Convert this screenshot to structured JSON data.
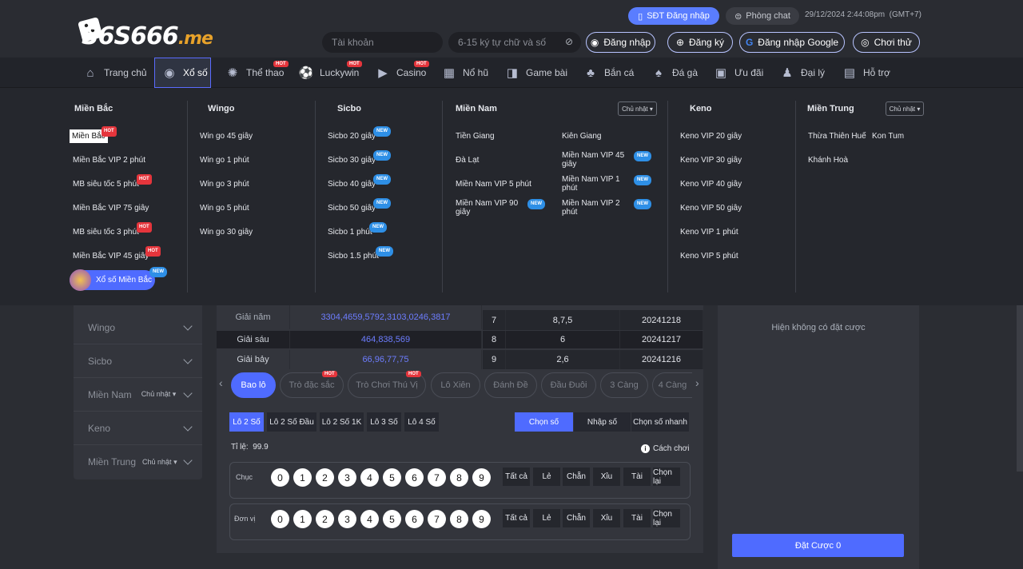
{
  "header": {
    "logo_text": "S6S666",
    "logo_suffix": ".me",
    "sdt_login": "SĐT Đăng nhập",
    "phong_chat": "Phòng chat",
    "datetime": "29/12/2024 2:44:08pm",
    "timezone": "(GMT+7)",
    "account_placeholder": "Tài khoản",
    "password_placeholder": "6-15 ký tự chữ và số",
    "login": "Đăng nhập",
    "register": "Đăng ký",
    "google_login": "Đăng nhập Google",
    "try": "Chơi thử"
  },
  "nav": [
    {
      "label": "Trang chủ",
      "icon": "home-icon"
    },
    {
      "label": "Xổ số",
      "icon": "lottery-icon",
      "active": true
    },
    {
      "label": "Thể thao",
      "icon": "sports-icon",
      "badge": "HOT"
    },
    {
      "label": "Luckywin",
      "icon": "ball-icon",
      "badge": "HOT"
    },
    {
      "label": "Casino",
      "icon": "play-icon",
      "badge": "HOT"
    },
    {
      "label": "Nổ hũ",
      "icon": "slot-icon"
    },
    {
      "label": "Game bài",
      "icon": "card-icon"
    },
    {
      "label": "Bắn cá",
      "icon": "fish-icon"
    },
    {
      "label": "Đá gà",
      "icon": "rooster-icon"
    },
    {
      "label": "Ưu đãi",
      "icon": "gift-icon"
    },
    {
      "label": "Đại lý",
      "icon": "agent-icon"
    },
    {
      "label": "Hỗ trợ",
      "icon": "support-icon"
    }
  ],
  "badges": {
    "hot": "HOT",
    "new": "NEW"
  },
  "dropdown": {
    "mien_bac": {
      "title": "Miền Bắc",
      "items": [
        "Miền Bắc",
        "Miền Bắc VIP 2 phút",
        "MB siêu tốc 5 phút",
        "Miền Bắc VIP 75 giây",
        "MB siêu tốc 3 phút",
        "Miền Bắc VIP 45 giây"
      ],
      "special": "Xổ số Miền Bắc"
    },
    "wingo": {
      "title": "Wingo",
      "items": [
        "Win go 45 giây",
        "Win go 1 phút",
        "Win go 3 phút",
        "Win go 5 phút",
        "Win go 30 giây"
      ]
    },
    "sicbo": {
      "title": "Sicbo",
      "items": [
        "Sicbo 20 giây",
        "Sicbo 30 giây",
        "Sicbo 40 giây",
        "Sicbo 50 giây",
        "Sicbo 1 phút",
        "Sicbo 1.5 phút"
      ]
    },
    "mien_nam": {
      "title": "Miền Nam",
      "select": "Chủ nhật",
      "left": [
        "Tiền Giang",
        "Đà Lạt",
        "Miền Nam VIP 5 phút",
        "Miền Nam VIP 90 giây"
      ],
      "right": [
        "Kiên Giang",
        "Miền Nam VIP 45 giây",
        "Miền Nam VIP 1 phút",
        "Miền Nam VIP 2 phút"
      ]
    },
    "keno": {
      "title": "Keno",
      "items": [
        "Keno VIP 20 giây",
        "Keno VIP 30 giây",
        "Keno VIP 40 giây",
        "Keno VIP 50 giây",
        "Keno VIP 1 phút",
        "Keno VIP 5 phút"
      ]
    },
    "mien_trung": {
      "title": "Miền Trung",
      "select": "Chủ nhật",
      "items": [
        "Thừa Thiên Huế",
        "Kon Tum",
        "Khánh Hoà"
      ]
    }
  },
  "sidebar": {
    "items": [
      {
        "label": "Wingo"
      },
      {
        "label": "Sicbo"
      },
      {
        "label": "Miền Nam",
        "select": "Chủ nhật"
      },
      {
        "label": "Keno"
      },
      {
        "label": "Miền Trung",
        "select": "Chủ nhật"
      }
    ]
  },
  "results": {
    "rows": [
      {
        "label": "Giải năm",
        "value": "3304,4659,5792,3103,0246,3817"
      },
      {
        "label": "Giải sáu",
        "value": "464,838,569"
      },
      {
        "label": "Giải bảy",
        "value": "66,96,77,75"
      }
    ],
    "history": [
      {
        "no": "7",
        "nums": "8,7,5",
        "date": "20241218"
      },
      {
        "no": "8",
        "nums": "6",
        "date": "20241217"
      },
      {
        "no": "9",
        "nums": "2,6",
        "date": "20241216"
      }
    ]
  },
  "game_tabs": [
    "Bao lô",
    "Trò đặc sắc",
    "Trò Chơi Thú Vị",
    "Lô Xiên",
    "Đánh Đề",
    "Đầu Đuôi",
    "3 Càng",
    "4 Càng"
  ],
  "sub_tabs": [
    "Lô 2 Số",
    "Lô 2 Số Đầu",
    "Lô 2 Số 1K",
    "Lô 3 Số",
    "Lô 4 Số"
  ],
  "mode_tabs": [
    "Chọn số",
    "Nhập số",
    "Chọn số nhanh"
  ],
  "ratio_label": "Tỉ lệ:",
  "ratio_value": "99.9",
  "how_to_play": "Cách chơi",
  "digit_rows": [
    {
      "label": "Chục"
    },
    {
      "label": "Đơn vị"
    }
  ],
  "digits": [
    "0",
    "1",
    "2",
    "3",
    "4",
    "5",
    "6",
    "7",
    "8",
    "9"
  ],
  "actions": [
    "Tất cả",
    "Lẻ",
    "Chẵn",
    "Xỉu",
    "Tài",
    "Chọn lại"
  ],
  "right_panel": {
    "empty": "Hiện không có đặt cược",
    "bet_button": "Đặt Cược 0"
  },
  "colors": {
    "accent": "#4f6bff",
    "hot": "#e5353c",
    "new": "#2e8fe6",
    "background": "#2b2d33"
  }
}
